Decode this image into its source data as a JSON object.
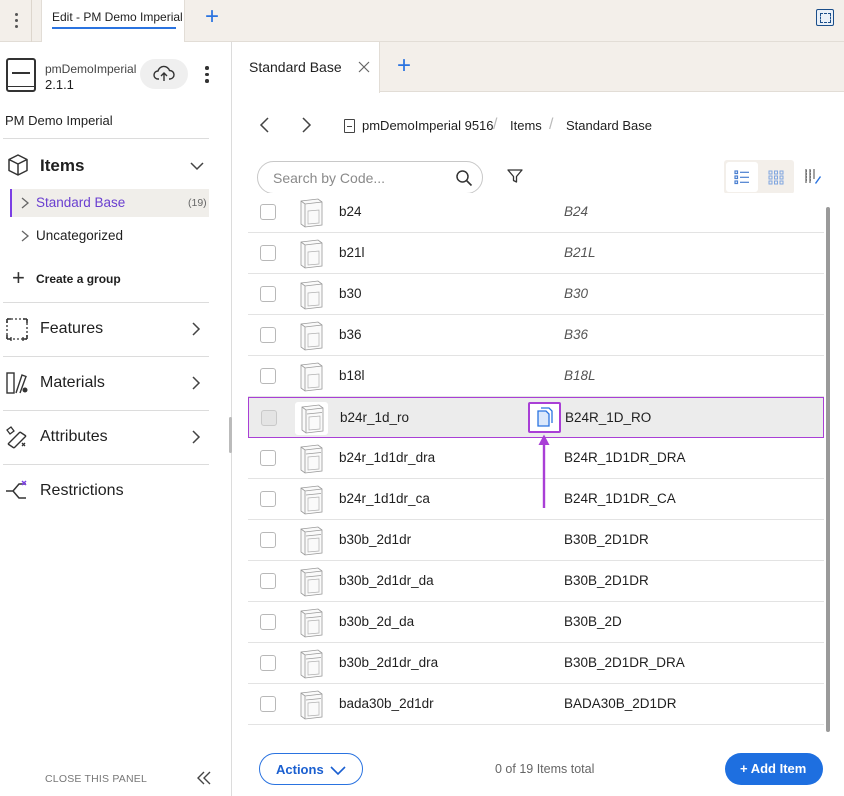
{
  "topbar": {
    "tab_label": "Edit - PM Demo Imperial"
  },
  "sidebar": {
    "library_name": "pmDemoImperial",
    "library_version": "2.1.1",
    "project_name": "PM Demo Imperial",
    "items_label": "Items",
    "groups": [
      {
        "label": "Standard Base",
        "count": "(19)",
        "active": true
      },
      {
        "label": "Uncategorized",
        "count": "",
        "active": false
      }
    ],
    "create_group_label": "Create a group",
    "nav": [
      {
        "label": "Features",
        "icon": "features-icon"
      },
      {
        "label": "Materials",
        "icon": "materials-icon"
      },
      {
        "label": "Attributes",
        "icon": "attributes-icon"
      },
      {
        "label": "Restrictions",
        "icon": "restrictions-icon"
      }
    ],
    "close_panel_label": "CLOSE THIS PANEL"
  },
  "main": {
    "tab_label": "Standard Base",
    "breadcrumb": [
      "pmDemoImperial 9516",
      "Items",
      "Standard Base"
    ],
    "search": {
      "placeholder": "Search by Code...",
      "value": ""
    },
    "rows": [
      {
        "code": "b24",
        "name": "B24",
        "italic": true,
        "selected": false
      },
      {
        "code": "b21l",
        "name": "B21L",
        "italic": true,
        "selected": false
      },
      {
        "code": "b30",
        "name": "B30",
        "italic": true,
        "selected": false
      },
      {
        "code": "b36",
        "name": "B36",
        "italic": true,
        "selected": false
      },
      {
        "code": "b18l",
        "name": "B18L",
        "italic": true,
        "selected": false
      },
      {
        "code": "b24r_1d_ro",
        "name": "B24R_1D_RO",
        "italic": false,
        "selected": true
      },
      {
        "code": "b24r_1d1dr_dra",
        "name": "B24R_1D1DR_DRA",
        "italic": false,
        "selected": false
      },
      {
        "code": "b24r_1d1dr_ca",
        "name": "B24R_1D1DR_CA",
        "italic": false,
        "selected": false
      },
      {
        "code": "b30b_2d1dr",
        "name": "B30B_2D1DR",
        "italic": false,
        "selected": false
      },
      {
        "code": "b30b_2d1dr_da",
        "name": "B30B_2D1DR",
        "italic": false,
        "selected": false
      },
      {
        "code": "b30b_2d_da",
        "name": "B30B_2D",
        "italic": false,
        "selected": false
      },
      {
        "code": "b30b_2d1dr_dra",
        "name": "B30B_2D1DR_DRA",
        "italic": false,
        "selected": false
      },
      {
        "code": "bada30b_2d1dr",
        "name": "BADA30B_2D1DR",
        "italic": false,
        "selected": false
      }
    ],
    "footer": {
      "actions_label": "Actions",
      "count_text": "0 of 19 Items total",
      "add_item_label": "+ Add Item"
    }
  },
  "colors": {
    "accent": "#1e6fe0",
    "highlight": "#a93fd6",
    "active_group": "#6a3fd0"
  }
}
